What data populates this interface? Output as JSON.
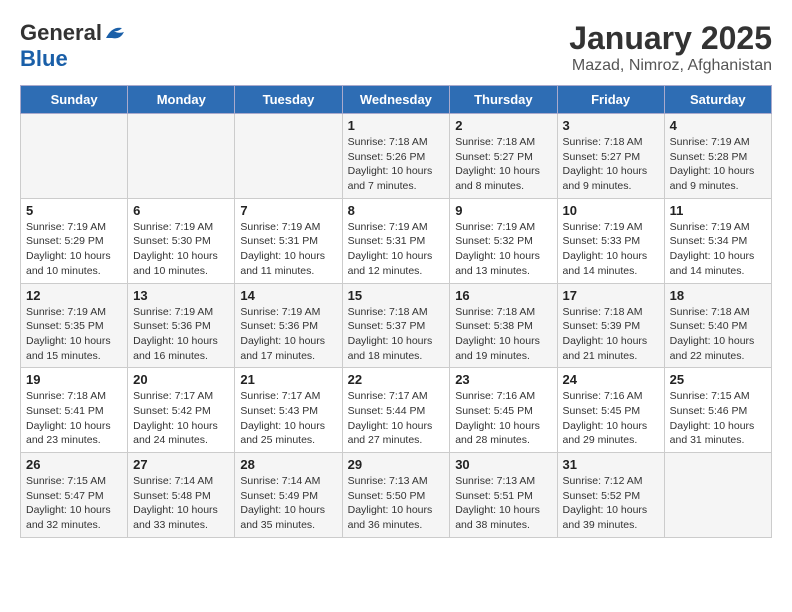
{
  "header": {
    "logo_line1": "General",
    "logo_line2": "Blue",
    "title": "January 2025",
    "subtitle": "Mazad, Nimroz, Afghanistan"
  },
  "weekdays": [
    "Sunday",
    "Monday",
    "Tuesday",
    "Wednesday",
    "Thursday",
    "Friday",
    "Saturday"
  ],
  "weeks": [
    [
      {
        "day": "",
        "info": ""
      },
      {
        "day": "",
        "info": ""
      },
      {
        "day": "",
        "info": ""
      },
      {
        "day": "1",
        "info": "Sunrise: 7:18 AM\nSunset: 5:26 PM\nDaylight: 10 hours\nand 7 minutes."
      },
      {
        "day": "2",
        "info": "Sunrise: 7:18 AM\nSunset: 5:27 PM\nDaylight: 10 hours\nand 8 minutes."
      },
      {
        "day": "3",
        "info": "Sunrise: 7:18 AM\nSunset: 5:27 PM\nDaylight: 10 hours\nand 9 minutes."
      },
      {
        "day": "4",
        "info": "Sunrise: 7:19 AM\nSunset: 5:28 PM\nDaylight: 10 hours\nand 9 minutes."
      }
    ],
    [
      {
        "day": "5",
        "info": "Sunrise: 7:19 AM\nSunset: 5:29 PM\nDaylight: 10 hours\nand 10 minutes."
      },
      {
        "day": "6",
        "info": "Sunrise: 7:19 AM\nSunset: 5:30 PM\nDaylight: 10 hours\nand 10 minutes."
      },
      {
        "day": "7",
        "info": "Sunrise: 7:19 AM\nSunset: 5:31 PM\nDaylight: 10 hours\nand 11 minutes."
      },
      {
        "day": "8",
        "info": "Sunrise: 7:19 AM\nSunset: 5:31 PM\nDaylight: 10 hours\nand 12 minutes."
      },
      {
        "day": "9",
        "info": "Sunrise: 7:19 AM\nSunset: 5:32 PM\nDaylight: 10 hours\nand 13 minutes."
      },
      {
        "day": "10",
        "info": "Sunrise: 7:19 AM\nSunset: 5:33 PM\nDaylight: 10 hours\nand 14 minutes."
      },
      {
        "day": "11",
        "info": "Sunrise: 7:19 AM\nSunset: 5:34 PM\nDaylight: 10 hours\nand 14 minutes."
      }
    ],
    [
      {
        "day": "12",
        "info": "Sunrise: 7:19 AM\nSunset: 5:35 PM\nDaylight: 10 hours\nand 15 minutes."
      },
      {
        "day": "13",
        "info": "Sunrise: 7:19 AM\nSunset: 5:36 PM\nDaylight: 10 hours\nand 16 minutes."
      },
      {
        "day": "14",
        "info": "Sunrise: 7:19 AM\nSunset: 5:36 PM\nDaylight: 10 hours\nand 17 minutes."
      },
      {
        "day": "15",
        "info": "Sunrise: 7:18 AM\nSunset: 5:37 PM\nDaylight: 10 hours\nand 18 minutes."
      },
      {
        "day": "16",
        "info": "Sunrise: 7:18 AM\nSunset: 5:38 PM\nDaylight: 10 hours\nand 19 minutes."
      },
      {
        "day": "17",
        "info": "Sunrise: 7:18 AM\nSunset: 5:39 PM\nDaylight: 10 hours\nand 21 minutes."
      },
      {
        "day": "18",
        "info": "Sunrise: 7:18 AM\nSunset: 5:40 PM\nDaylight: 10 hours\nand 22 minutes."
      }
    ],
    [
      {
        "day": "19",
        "info": "Sunrise: 7:18 AM\nSunset: 5:41 PM\nDaylight: 10 hours\nand 23 minutes."
      },
      {
        "day": "20",
        "info": "Sunrise: 7:17 AM\nSunset: 5:42 PM\nDaylight: 10 hours\nand 24 minutes."
      },
      {
        "day": "21",
        "info": "Sunrise: 7:17 AM\nSunset: 5:43 PM\nDaylight: 10 hours\nand 25 minutes."
      },
      {
        "day": "22",
        "info": "Sunrise: 7:17 AM\nSunset: 5:44 PM\nDaylight: 10 hours\nand 27 minutes."
      },
      {
        "day": "23",
        "info": "Sunrise: 7:16 AM\nSunset: 5:45 PM\nDaylight: 10 hours\nand 28 minutes."
      },
      {
        "day": "24",
        "info": "Sunrise: 7:16 AM\nSunset: 5:45 PM\nDaylight: 10 hours\nand 29 minutes."
      },
      {
        "day": "25",
        "info": "Sunrise: 7:15 AM\nSunset: 5:46 PM\nDaylight: 10 hours\nand 31 minutes."
      }
    ],
    [
      {
        "day": "26",
        "info": "Sunrise: 7:15 AM\nSunset: 5:47 PM\nDaylight: 10 hours\nand 32 minutes."
      },
      {
        "day": "27",
        "info": "Sunrise: 7:14 AM\nSunset: 5:48 PM\nDaylight: 10 hours\nand 33 minutes."
      },
      {
        "day": "28",
        "info": "Sunrise: 7:14 AM\nSunset: 5:49 PM\nDaylight: 10 hours\nand 35 minutes."
      },
      {
        "day": "29",
        "info": "Sunrise: 7:13 AM\nSunset: 5:50 PM\nDaylight: 10 hours\nand 36 minutes."
      },
      {
        "day": "30",
        "info": "Sunrise: 7:13 AM\nSunset: 5:51 PM\nDaylight: 10 hours\nand 38 minutes."
      },
      {
        "day": "31",
        "info": "Sunrise: 7:12 AM\nSunset: 5:52 PM\nDaylight: 10 hours\nand 39 minutes."
      },
      {
        "day": "",
        "info": ""
      }
    ]
  ]
}
